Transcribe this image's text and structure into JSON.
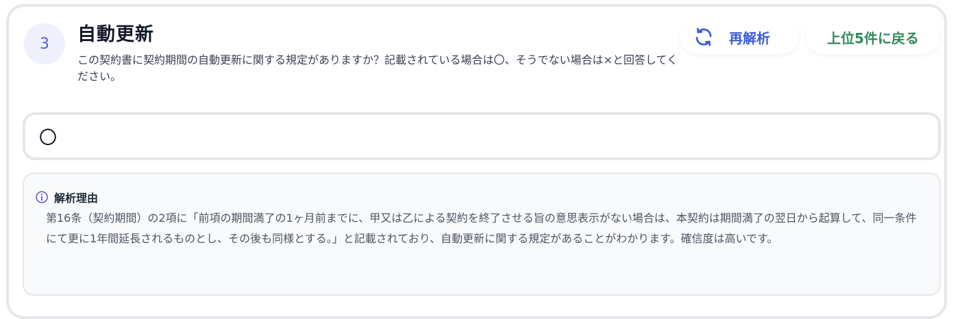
{
  "step": {
    "number": "3",
    "title": "自動更新",
    "question": "この契約書に契約期間の自動更新に関する規定がありますか？記載されている場合は〇、そうでない場合は×と回答してください。"
  },
  "actions": {
    "reanalyze_label": "再解析",
    "back_label": "上位5件に戻る"
  },
  "answer": {
    "value": "〇"
  },
  "reason": {
    "heading": "解析理由",
    "text": "第16条（契約期間）の2項に「前項の期間満了の1ヶ月前までに、甲又は乙による契約を終了させる旨の意思表示がない場合は、本契約は期間満了の翌日から起算して、同一条件にて更に1年間延長されるものとし、その後も同様とする。」と記載されており、自動更新に関する規定があることがわかります。確信度は高いです。"
  },
  "colors": {
    "badge_bg": "#eef0fd",
    "badge_text": "#5b5bd6",
    "reanalyze": "#3b5bdb",
    "back": "#2f8a5b",
    "info_icon": "#5b5bd6"
  },
  "icons": {
    "reanalyze": "refresh-icon",
    "reason": "info-icon"
  }
}
